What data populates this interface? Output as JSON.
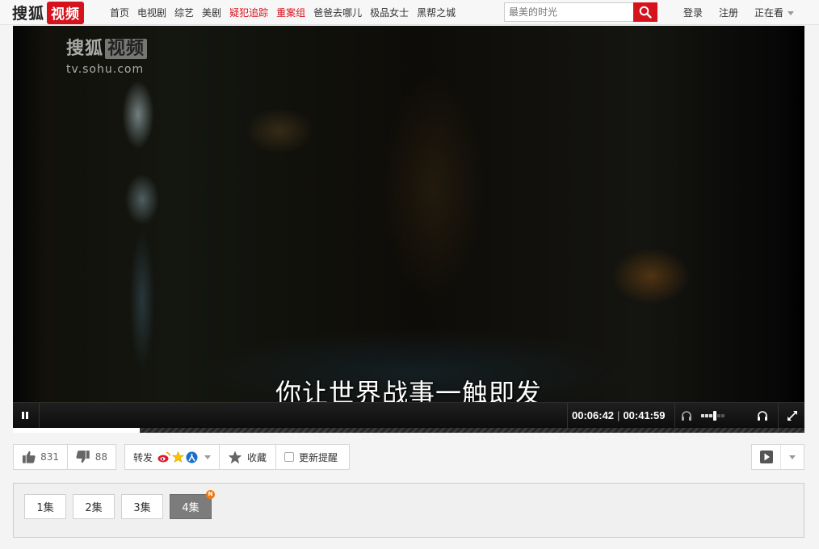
{
  "logo": {
    "text_a": "搜狐",
    "text_b": "视频"
  },
  "nav": {
    "items": [
      {
        "label": "首页",
        "hot": false
      },
      {
        "label": "电视剧",
        "hot": false
      },
      {
        "label": "综艺",
        "hot": false
      },
      {
        "label": "美剧",
        "hot": false
      },
      {
        "label": "疑犯追踪",
        "hot": true
      },
      {
        "label": "重案组",
        "hot": true
      },
      {
        "label": "爸爸去哪儿",
        "hot": false
      },
      {
        "label": "极品女士",
        "hot": false
      },
      {
        "label": "黑帮之城",
        "hot": false
      }
    ]
  },
  "search": {
    "placeholder": "最美的时光",
    "icon": "search-icon"
  },
  "header_links": {
    "login": "登录",
    "register": "注册",
    "watching": "正在看"
  },
  "player": {
    "watermark_brand": "搜狐",
    "watermark_brand_box": "视频",
    "watermark_url": "tv.sohu.com",
    "subtitle": "你让世界战事一触即发",
    "current_time": "00:06:42",
    "time_separator": "|",
    "total_time": "00:41:59",
    "volume_level": 0.55,
    "progress_fraction": 0.16
  },
  "actions": {
    "like_count": "831",
    "dislike_count": "88",
    "share_label": "转发",
    "favorite_label": "收藏",
    "update_reminder_label": "更新提醒"
  },
  "episodes": {
    "items": [
      {
        "label": "1集",
        "active": false,
        "new": false
      },
      {
        "label": "2集",
        "active": false,
        "new": false
      },
      {
        "label": "3集",
        "active": false,
        "new": false
      },
      {
        "label": "4集",
        "active": true,
        "new": true
      }
    ],
    "new_badge": "N"
  },
  "colors": {
    "brand_red": "#d6121c",
    "badge_orange": "#f07a12",
    "active_episode": "#7c7c7c"
  }
}
